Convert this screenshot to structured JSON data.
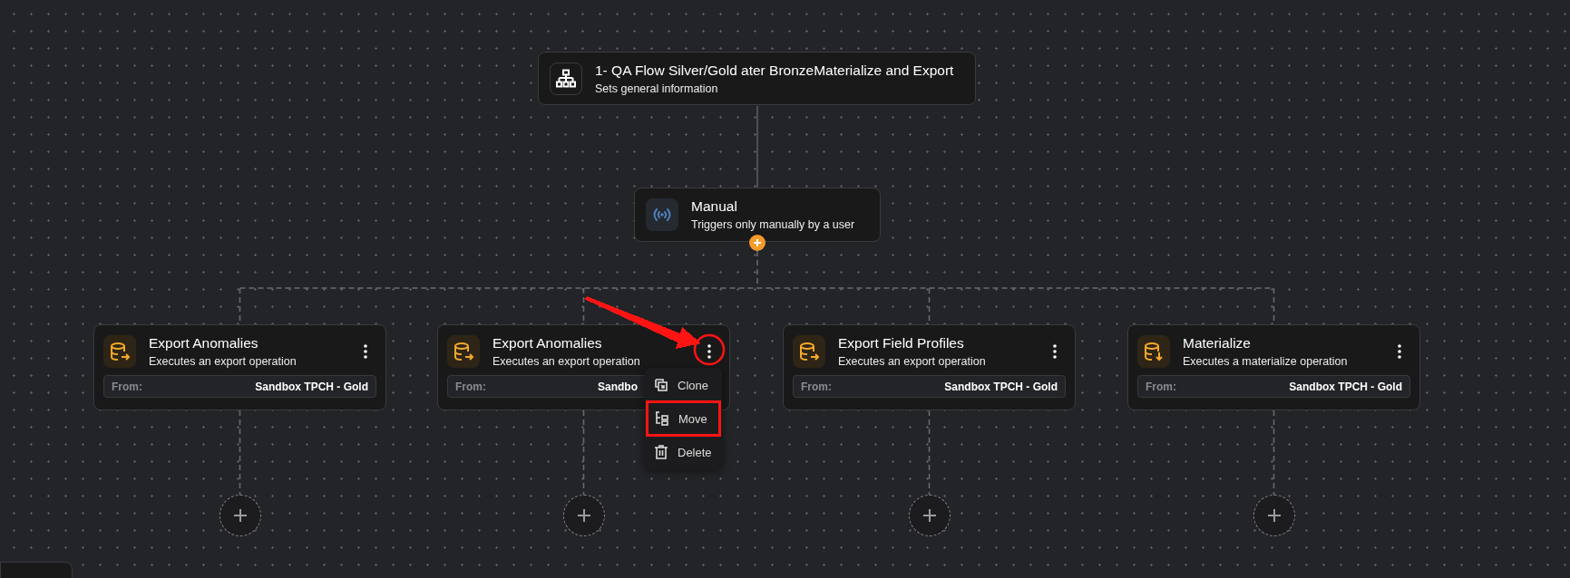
{
  "root": {
    "title": "1- QA Flow Silver/Gold ater BronzeMaterialize and Export",
    "subtitle": "Sets general information"
  },
  "trigger": {
    "title": "Manual",
    "subtitle": "Triggers only manually by a user"
  },
  "steps": [
    {
      "kind": "export",
      "title": "Export Anomalies",
      "subtitle": "Executes an export operation",
      "from_label": "From:",
      "from_value": "Sandbox TPCH - Gold",
      "menu_open": false
    },
    {
      "kind": "export",
      "title": "Export Anomalies",
      "subtitle": "Executes an export operation",
      "from_label": "From:",
      "from_value": "Sandbo",
      "menu_open": true
    },
    {
      "kind": "export",
      "title": "Export Field Profiles",
      "subtitle": "Executes an export operation",
      "from_label": "From:",
      "from_value": "Sandbox TPCH - Gold",
      "menu_open": false
    },
    {
      "kind": "materialize",
      "title": "Materialize",
      "subtitle": "Executes a materialize operation",
      "from_label": "From:",
      "from_value": "Sandbox TPCH - Gold",
      "menu_open": false
    }
  ],
  "menu": {
    "items": [
      {
        "kind": "clone",
        "label": "Clone"
      },
      {
        "kind": "move",
        "label": "Move"
      },
      {
        "kind": "delete",
        "label": "Delete"
      }
    ]
  },
  "annotations": [
    {
      "kind": "arrow",
      "color": "#ff1414"
    },
    {
      "kind": "circle",
      "color": "#ff1414"
    },
    {
      "kind": "rectangle",
      "color": "#ff1414"
    }
  ]
}
